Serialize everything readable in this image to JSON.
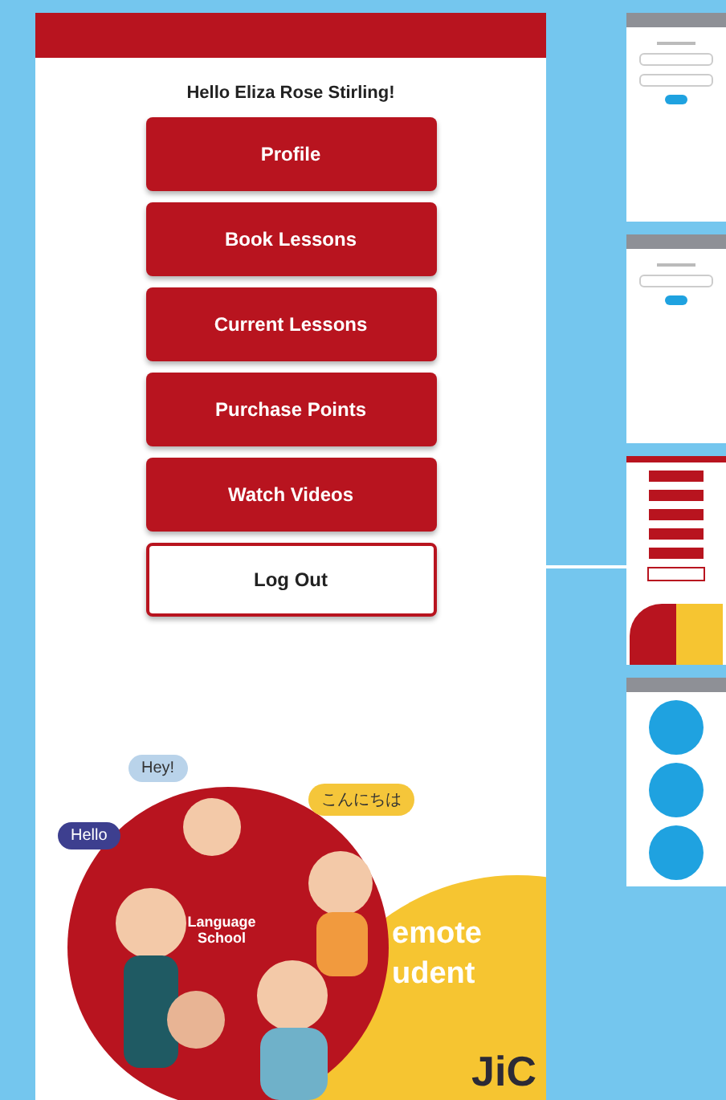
{
  "greeting": "Hello Eliza Rose Stirling!",
  "menu_buttons": [
    {
      "label": "Profile",
      "kind": "primary"
    },
    {
      "label": "Book Lessons",
      "kind": "primary"
    },
    {
      "label": "Current Lessons",
      "kind": "primary"
    },
    {
      "label": "Purchase Points",
      "kind": "primary"
    },
    {
      "label": "Watch Videos",
      "kind": "primary"
    },
    {
      "label": "Log Out",
      "kind": "outline"
    }
  ],
  "illustration": {
    "bubbles": [
      {
        "text": "Hey!",
        "color": "#b9d3ea"
      },
      {
        "text": "Hello",
        "color": "#3d3f8f"
      },
      {
        "text": "こんにちは",
        "color": "#f5c63a"
      }
    ],
    "sign": "Language School",
    "title_lines": [
      "emote",
      "udent"
    ],
    "logo": "JiC"
  },
  "screens": [
    {
      "kind": "login"
    },
    {
      "kind": "reset"
    },
    {
      "kind": "menu"
    },
    {
      "kind": "profile"
    }
  ]
}
